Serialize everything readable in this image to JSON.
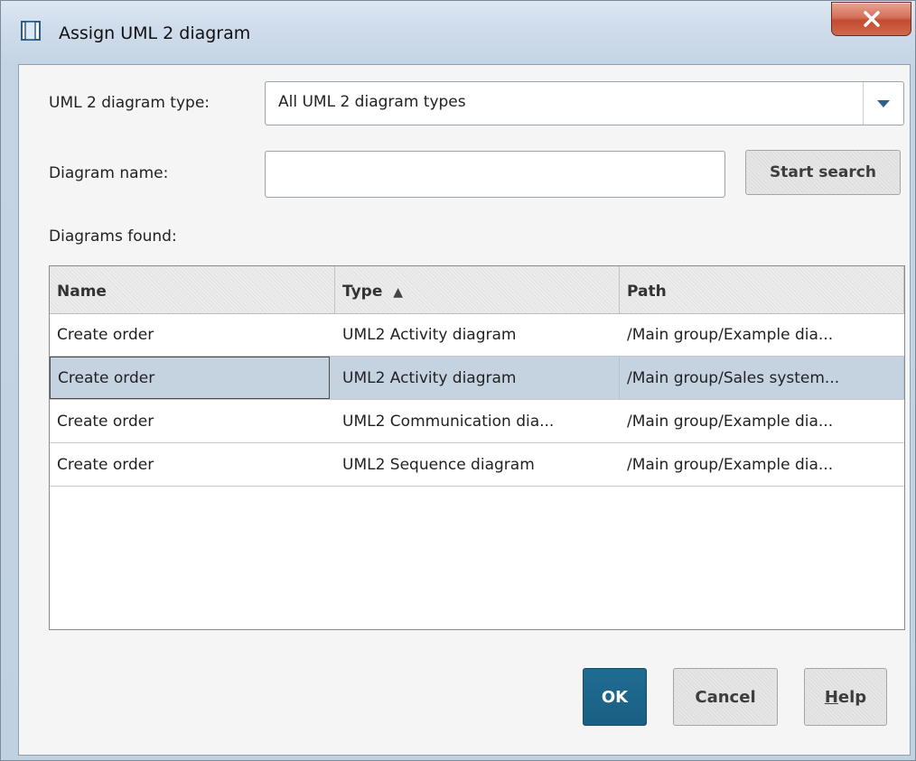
{
  "window": {
    "title": "Assign UML 2 diagram",
    "close_glyph": "X",
    "icon": "window-icon",
    "close_icon": "close-icon"
  },
  "form": {
    "diagram_type_label": "UML 2 diagram type:",
    "diagram_type_value": "All UML 2 diagram types",
    "diagram_name_label": "Diagram name:",
    "diagram_name_value": "",
    "start_search_label": "Start search",
    "diagrams_found_label": "Diagrams found:"
  },
  "table": {
    "columns": [
      {
        "label": "Name",
        "sort": ""
      },
      {
        "label": "Type",
        "sort": "▲"
      },
      {
        "label": "Path",
        "sort": ""
      }
    ],
    "rows": [
      {
        "name": "Create order",
        "type": "UML2 Activity diagram",
        "path": "/Main group/Example dia...",
        "selected": false
      },
      {
        "name": "Create order",
        "type": "UML2 Activity diagram",
        "path": "/Main group/Sales system...",
        "selected": true
      },
      {
        "name": "Create order",
        "type": "UML2 Communication dia...",
        "path": "/Main group/Example dia...",
        "selected": false
      },
      {
        "name": "Create order",
        "type": "UML2 Sequence diagram",
        "path": "/Main group/Example dia...",
        "selected": false
      }
    ]
  },
  "buttons": {
    "ok": "OK",
    "cancel": "Cancel",
    "help_mnemonic": "H",
    "help_rest": "elp"
  },
  "colors": {
    "accent": "#1a5f83",
    "selection": "#c5d3e1",
    "close": "#c44a30"
  }
}
